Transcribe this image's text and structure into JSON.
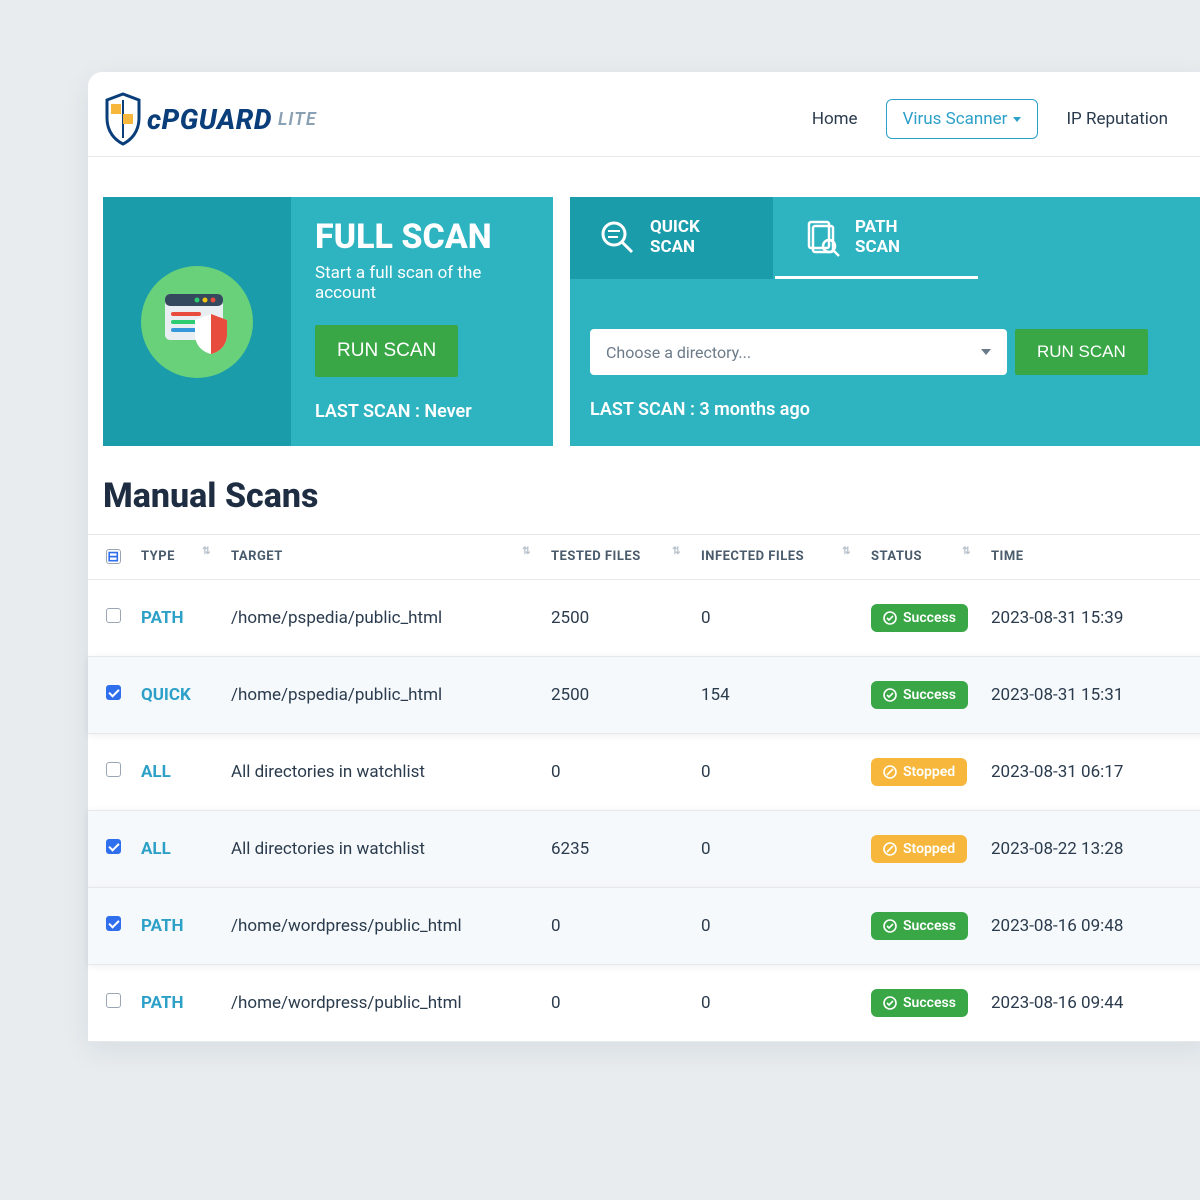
{
  "logo": {
    "main": "cPGUARD",
    "sub": "LITE"
  },
  "nav": {
    "home": "Home",
    "scanner": "Virus Scanner",
    "ip": "IP Reputation"
  },
  "full": {
    "title": "FULL SCAN",
    "subtitle": "Start a full scan of the account",
    "run": "RUN SCAN",
    "last": "LAST SCAN : Never"
  },
  "tabs": {
    "quick": "QUICK\nSCAN",
    "path": "PATH\nSCAN"
  },
  "path": {
    "placeholder": "Choose a directory...",
    "run": "RUN SCAN",
    "last": "LAST SCAN : 3 months ago"
  },
  "section": "Manual Scans",
  "cols": {
    "type": "TYPE",
    "target": "TARGET",
    "tested": "TESTED FILES",
    "infected": "INFECTED FILES",
    "status": "STATUS",
    "time": "TIME"
  },
  "status_labels": {
    "success": "Success",
    "stopped": "Stopped"
  },
  "rows": [
    {
      "checked": false,
      "type": "PATH",
      "target": "/home/pspedia/public_html",
      "tested": "2500",
      "infected": "0",
      "status": "success",
      "time": "2023-08-31 15:39"
    },
    {
      "checked": true,
      "type": "QUICK",
      "target": "/home/pspedia/public_html",
      "tested": "2500",
      "infected": "154",
      "status": "success",
      "time": "2023-08-31 15:31"
    },
    {
      "checked": false,
      "type": "ALL",
      "target": "All directories in watchlist",
      "tested": "0",
      "infected": "0",
      "status": "stopped",
      "time": "2023-08-31 06:17"
    },
    {
      "checked": true,
      "type": "ALL",
      "target": "All directories in watchlist",
      "tested": "6235",
      "infected": "0",
      "status": "stopped",
      "time": "2023-08-22 13:28"
    },
    {
      "checked": true,
      "type": "PATH",
      "target": "/home/wordpress/public_html",
      "tested": "0",
      "infected": "0",
      "status": "success",
      "time": "2023-08-16 09:48"
    },
    {
      "checked": false,
      "type": "PATH",
      "target": "/home/wordpress/public_html",
      "tested": "0",
      "infected": "0",
      "status": "success",
      "time": "2023-08-16 09:44"
    }
  ]
}
